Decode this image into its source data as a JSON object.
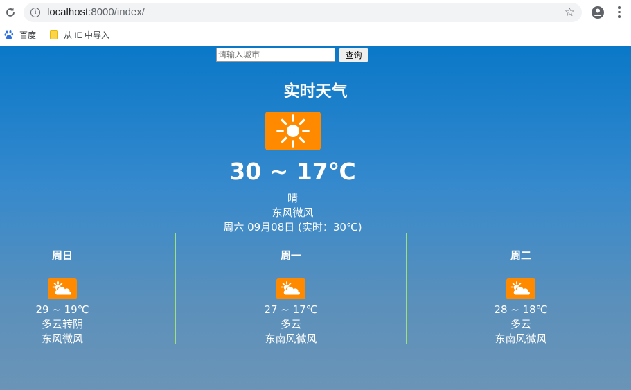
{
  "browser": {
    "url_host": "localhost",
    "url_rest": ":8000/index/",
    "bookmarks": [
      {
        "label": "百度",
        "icon": "baidu-paw-icon"
      },
      {
        "label": "从 IE 中导入",
        "icon": "folder-icon"
      }
    ]
  },
  "search": {
    "placeholder": "请输入城市",
    "button_label": "查询"
  },
  "current": {
    "title": "实时天气",
    "icon": "sunny-icon",
    "temp_range": "30 ~ 17℃",
    "condition": "晴",
    "wind": "东风微风",
    "date_line": "周六 09月08日 (实时：30℃)"
  },
  "forecast": [
    {
      "day": "周日",
      "icon": "partly-cloudy-icon",
      "temp": "29 ~ 19℃",
      "condition": "多云转阴",
      "wind": "东风微风"
    },
    {
      "day": "周一",
      "icon": "partly-cloudy-icon",
      "temp": "27 ~ 17℃",
      "condition": "多云",
      "wind": "东南风微风"
    },
    {
      "day": "周二",
      "icon": "partly-cloudy-icon",
      "temp": "28 ~ 18℃",
      "condition": "多云",
      "wind": "东南风微风"
    }
  ],
  "colors": {
    "icon_bg": "#ff8a00",
    "divider": "#9ee07a",
    "gradient_top": "#0a78c8",
    "gradient_bottom": "#6b94b7"
  }
}
